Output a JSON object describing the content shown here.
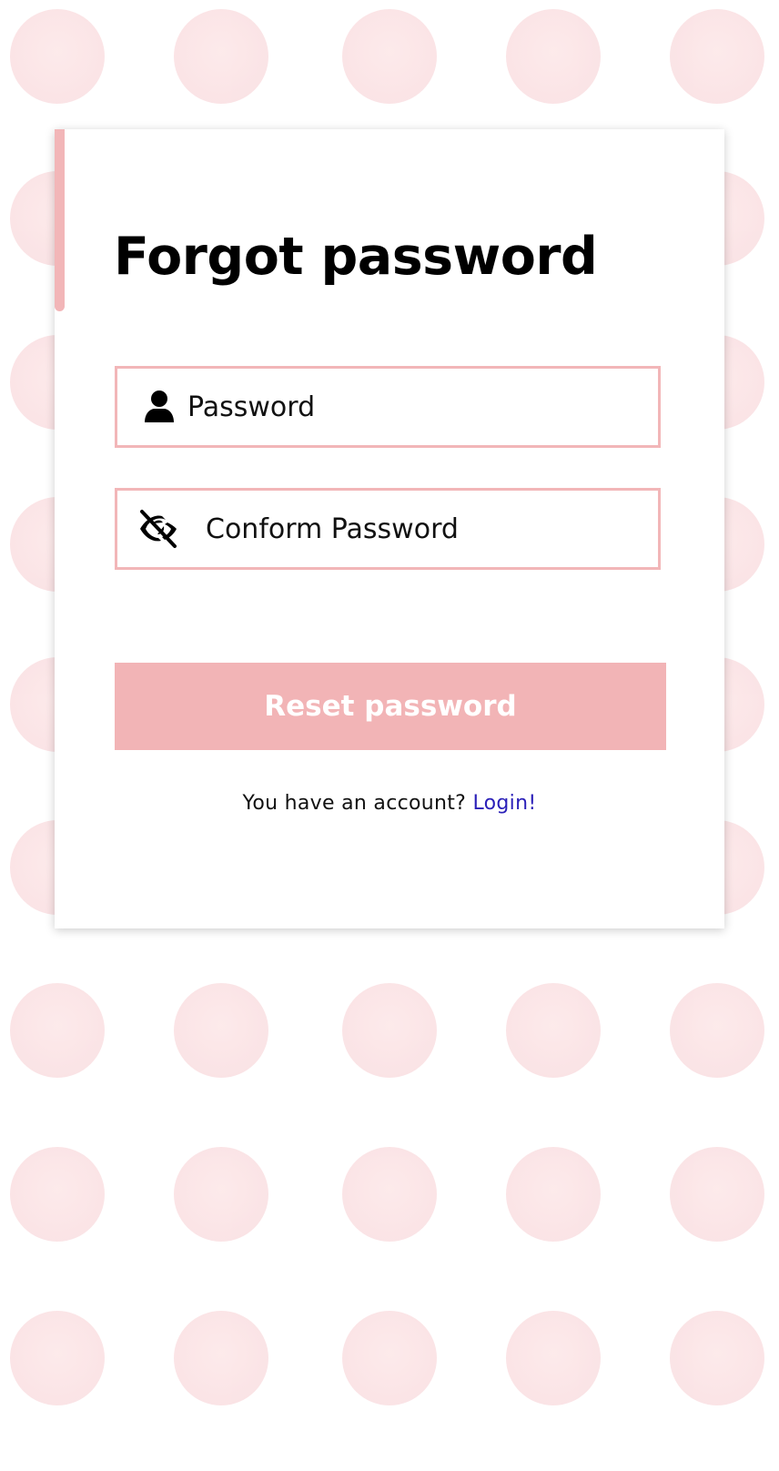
{
  "colors": {
    "accent": "#f2b6b8",
    "button_bg": "#f2b4b6",
    "link": "#2a1fb8",
    "dot": "#fbe2e3"
  },
  "form": {
    "title": "Forgot password",
    "password_field": {
      "icon": "user-icon",
      "placeholder": "Password",
      "value": ""
    },
    "confirm_field": {
      "icon": "eye-slash-icon",
      "placeholder": "Conform Password",
      "value": ""
    },
    "submit_label": "Reset password",
    "footer": {
      "prompt": "You have an account?",
      "link_label": "Login!"
    }
  }
}
